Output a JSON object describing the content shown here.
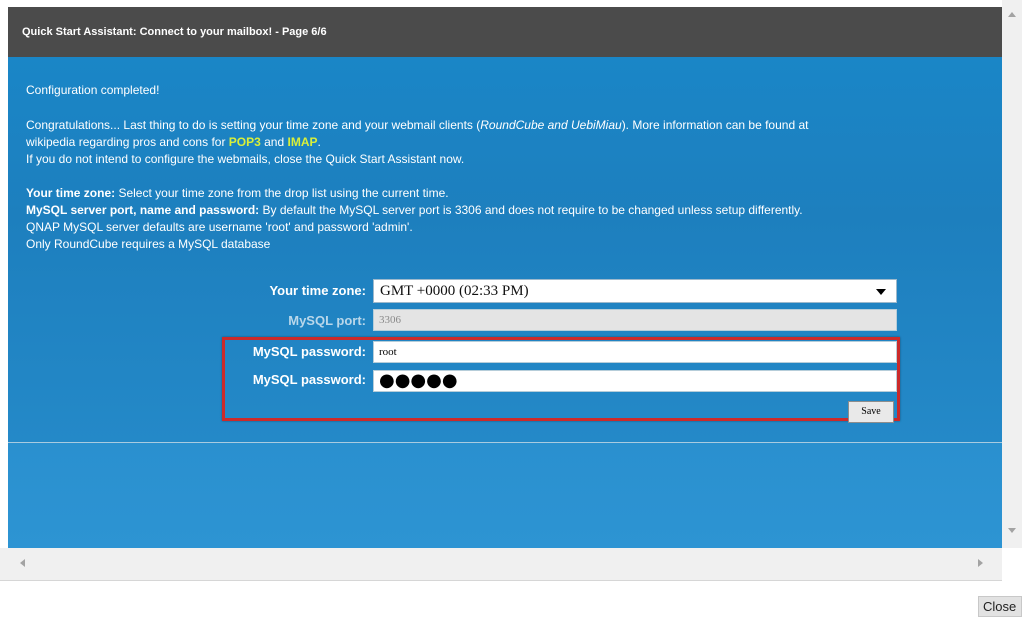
{
  "dialog": {
    "title": "Quick Start Assistant: Connect to your mailbox! - Page 6/6"
  },
  "content": {
    "completed": "Configuration completed!",
    "intro_1": "Congratulations... Last thing to do is setting your time zone and your webmail clients (",
    "intro_clients": "RoundCube and UebiMiau",
    "intro_2": "). More information can be found at",
    "intro_3": "wikipedia regarding pros and cons for ",
    "pop3": "POP3",
    "and": " and ",
    "imap": "IMAP",
    "period": ".",
    "intro_4": "If you do not intend to configure the webmails, close the Quick Start Assistant now.",
    "tz_bold": "Your time zone:",
    "tz_text": " Select your time zone from the drop list using the current time.",
    "mysql_bold": "MySQL server port, name and password:",
    "mysql_text": " By default the MySQL server port is 3306 and does not require to be changed unless setup differently.",
    "defaults": "QNAP MySQL server defaults are username 'root' and password 'admin'.",
    "roundcube": "Only RoundCube requires a MySQL database"
  },
  "form": {
    "timezone_label": "Your time zone:",
    "timezone_value": "GMT +0000 (02:33 PM)",
    "port_label": "MySQL port:",
    "port_value": "3306",
    "user_label": "MySQL password:",
    "user_value": "root",
    "password_label": "MySQL password:",
    "password_value": "●●●●●",
    "save_label": "Save"
  },
  "footer": {
    "close_label": "Close"
  },
  "icons": {
    "scroll_up": "scroll-up-arrow-icon",
    "scroll_down": "scroll-down-arrow-icon",
    "scroll_left": "scroll-left-arrow-icon",
    "scroll_right": "scroll-right-arrow-icon",
    "dropdown": "chevron-down-icon"
  },
  "colors": {
    "titlebar": "#4b4b4b",
    "panel": "#1d7fbe",
    "link_yellow": "#d9ef3a",
    "highlight_red": "#cc2a2a"
  }
}
